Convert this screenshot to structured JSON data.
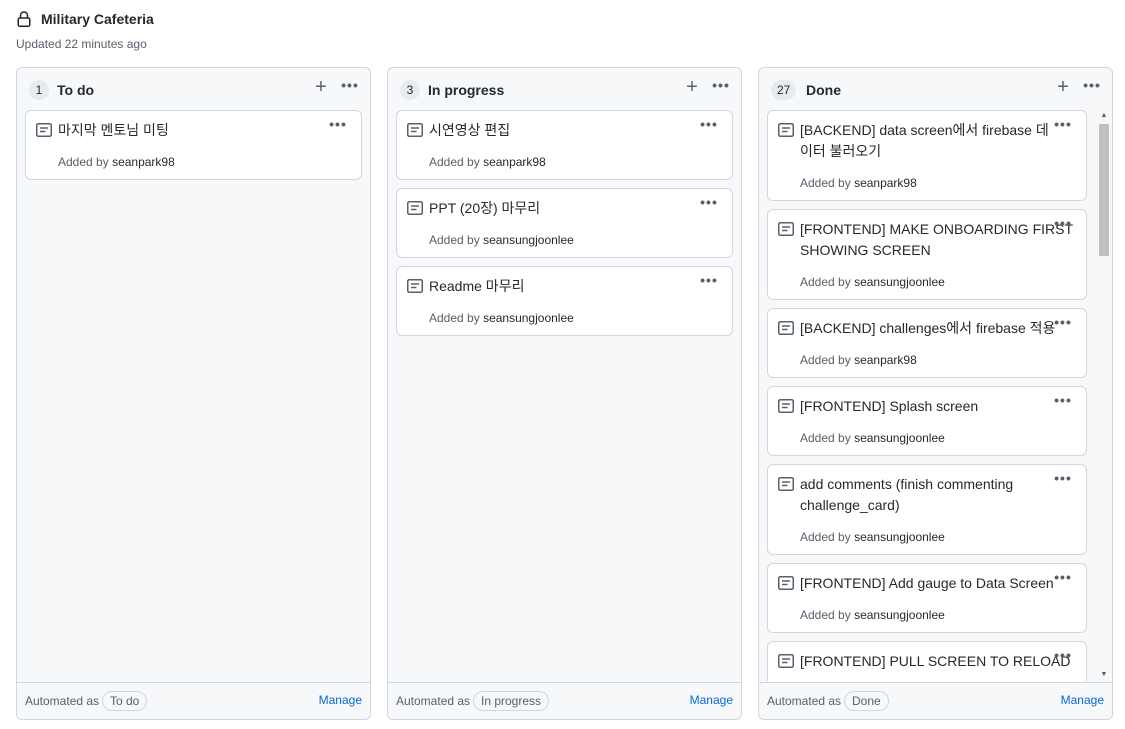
{
  "project": {
    "title": "Military Cafeteria",
    "updated": "Updated 22 minutes ago"
  },
  "columns": [
    {
      "count": "1",
      "name": "To do",
      "automated_label": "Automated as",
      "automated_value": "To do",
      "manage": "Manage",
      "cards": [
        {
          "title": "마지막 멘토님 미팅",
          "added_prefix": "Added by",
          "user": "seanpark98"
        }
      ]
    },
    {
      "count": "3",
      "name": "In progress",
      "automated_label": "Automated as",
      "automated_value": "In progress",
      "manage": "Manage",
      "cards": [
        {
          "title": "시연영상 편집",
          "added_prefix": "Added by",
          "user": "seanpark98"
        },
        {
          "title": "PPT (20장) 마무리",
          "added_prefix": "Added by",
          "user": "seansungjoonlee"
        },
        {
          "title": "Readme 마무리",
          "added_prefix": "Added by",
          "user": "seansungjoonlee"
        }
      ]
    },
    {
      "count": "27",
      "name": "Done",
      "automated_label": "Automated as",
      "automated_value": "Done",
      "manage": "Manage",
      "cards": [
        {
          "title_line1": "[BACKEND] data screen에서 firebase 데",
          "title_line2": "이터 불러오기",
          "added_prefix": "Added by",
          "user": "seanpark98"
        },
        {
          "title_line1": "[FRONTEND] MAKE ONBOARDING FIRST",
          "title_line2": "SHOWING SCREEN",
          "added_prefix": "Added by",
          "user": "seansungjoonlee"
        },
        {
          "title": "[BACKEND] challenges에서 firebase 적용",
          "added_prefix": "Added by",
          "user": "seanpark98"
        },
        {
          "title": "[FRONTEND] Splash screen",
          "added_prefix": "Added by",
          "user": "seansungjoonlee"
        },
        {
          "title_line1": "add comments (finish commenting",
          "title_line2": "challenge_card)",
          "added_prefix": "Added by",
          "user": "seansungjoonlee"
        },
        {
          "title": "[FRONTEND] Add gauge to Data Screen",
          "added_prefix": "Added by",
          "user": "seansungjoonlee"
        },
        {
          "title": "[FRONTEND] PULL SCREEN TO RELOAD"
        }
      ]
    }
  ],
  "icons": {
    "lock": "lock-icon",
    "note": "note-icon",
    "add": "plus-icon",
    "more": "kebab-horizontal-icon"
  },
  "colors": {
    "link": "#0969da",
    "muted": "#57606a",
    "border": "#d0d7de",
    "column_bg": "#f6f8fa"
  }
}
